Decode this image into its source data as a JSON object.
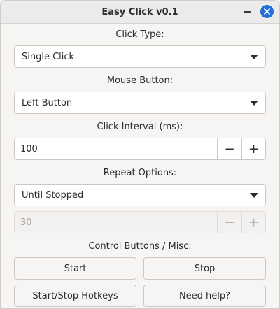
{
  "window": {
    "title": "Easy Click v0.1"
  },
  "click_type": {
    "label": "Click Type:",
    "selected": "Single Click"
  },
  "mouse_button": {
    "label": "Mouse Button:",
    "selected": "Left Button"
  },
  "click_interval": {
    "label": "Click Interval (ms):",
    "value": "100",
    "decrement": "−",
    "increment": "+"
  },
  "repeat_options": {
    "label": "Repeat Options:",
    "selected": "Until Stopped",
    "count_value": "30",
    "count_enabled": false,
    "decrement": "−",
    "increment": "+"
  },
  "controls": {
    "label": "Control Buttons / Misc:",
    "start": "Start",
    "stop": "Stop",
    "hotkeys": "Start/Stop Hotkeys",
    "help": "Need help?"
  },
  "colors": {
    "close_button": "#1f6fd6",
    "background": "#f6f5f4",
    "titlebar": "#ebebeb"
  },
  "icons": {
    "minimize": "minimize-icon",
    "close": "close-icon",
    "dropdown": "chevron-down-icon"
  }
}
